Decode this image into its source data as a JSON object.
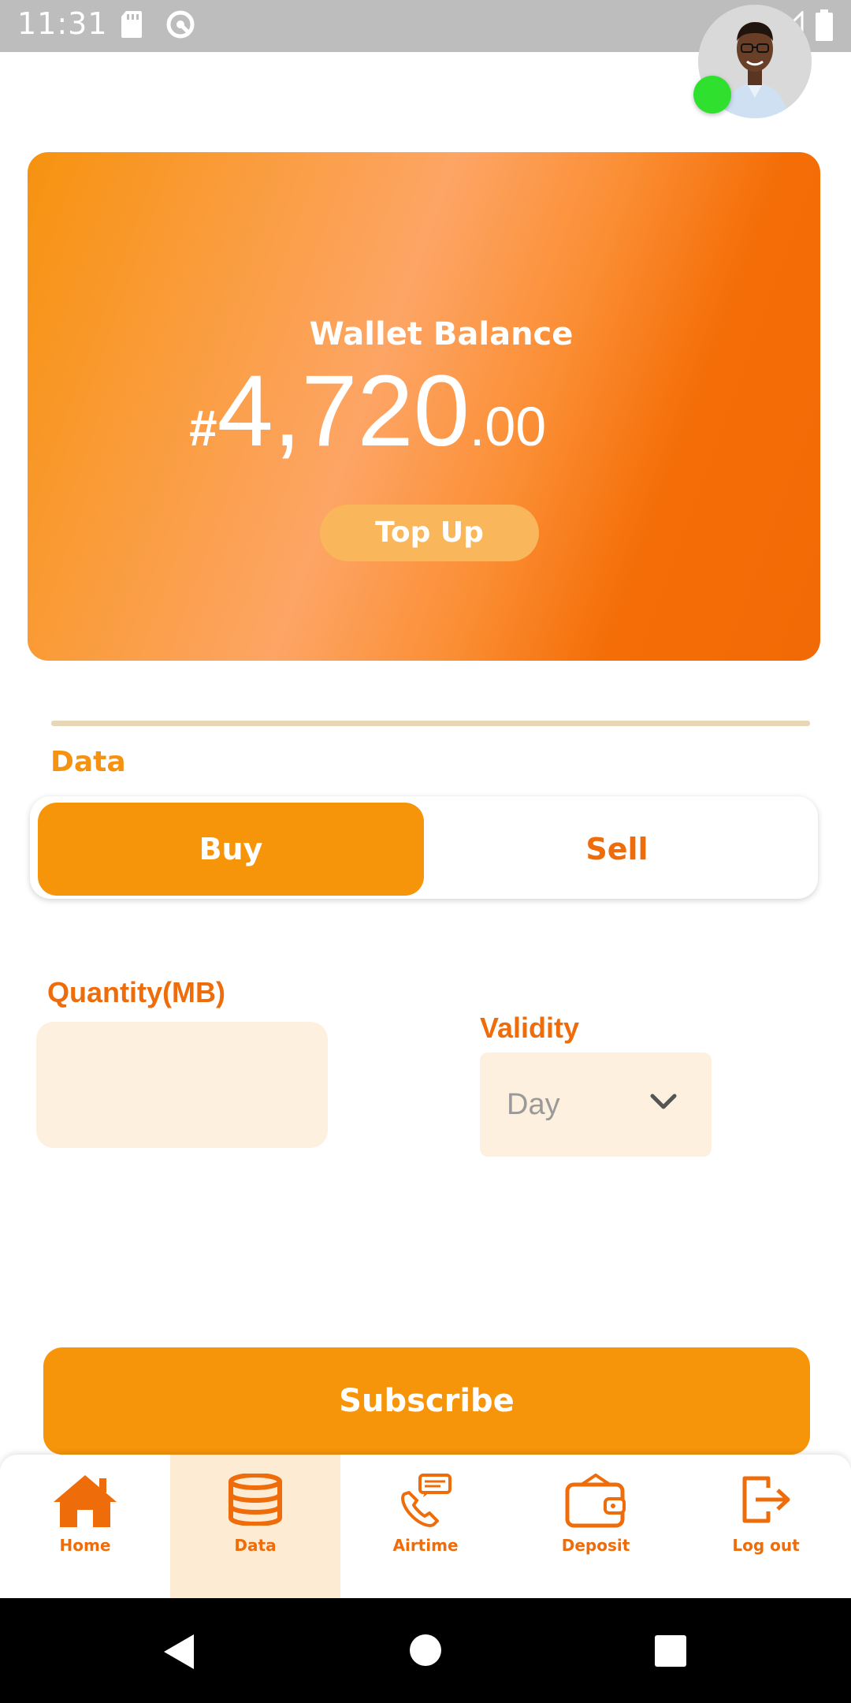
{
  "status_bar": {
    "time": "11:31"
  },
  "wallet": {
    "title": "Wallet Balance",
    "currency_symbol": "#",
    "amount_whole": "4,720",
    "amount_cents": ".00",
    "top_up_label": "Top Up"
  },
  "data_section": {
    "title": "Data",
    "tabs": [
      {
        "label": "Buy",
        "selected": true
      },
      {
        "label": "Sell",
        "selected": false
      }
    ]
  },
  "form": {
    "quantity_label": "Quantity(MB)",
    "quantity_value": "",
    "validity_label": "Validity",
    "validity_selected": "Day"
  },
  "subscribe_label": "Subscribe",
  "bottom_nav": {
    "items": [
      {
        "label": "Home",
        "icon": "home-icon",
        "active": false
      },
      {
        "label": "Data",
        "icon": "database-icon",
        "active": true
      },
      {
        "label": "Airtime",
        "icon": "phone-message-icon",
        "active": false
      },
      {
        "label": "Deposit",
        "icon": "wallet-icon",
        "active": false
      },
      {
        "label": "Log out",
        "icon": "logout-icon",
        "active": false
      }
    ]
  },
  "colors": {
    "accent": "#f7950a",
    "accent_dark": "#ef6c0a",
    "field_bg": "#fef0df",
    "nav_active_bg": "#fdebd3"
  }
}
